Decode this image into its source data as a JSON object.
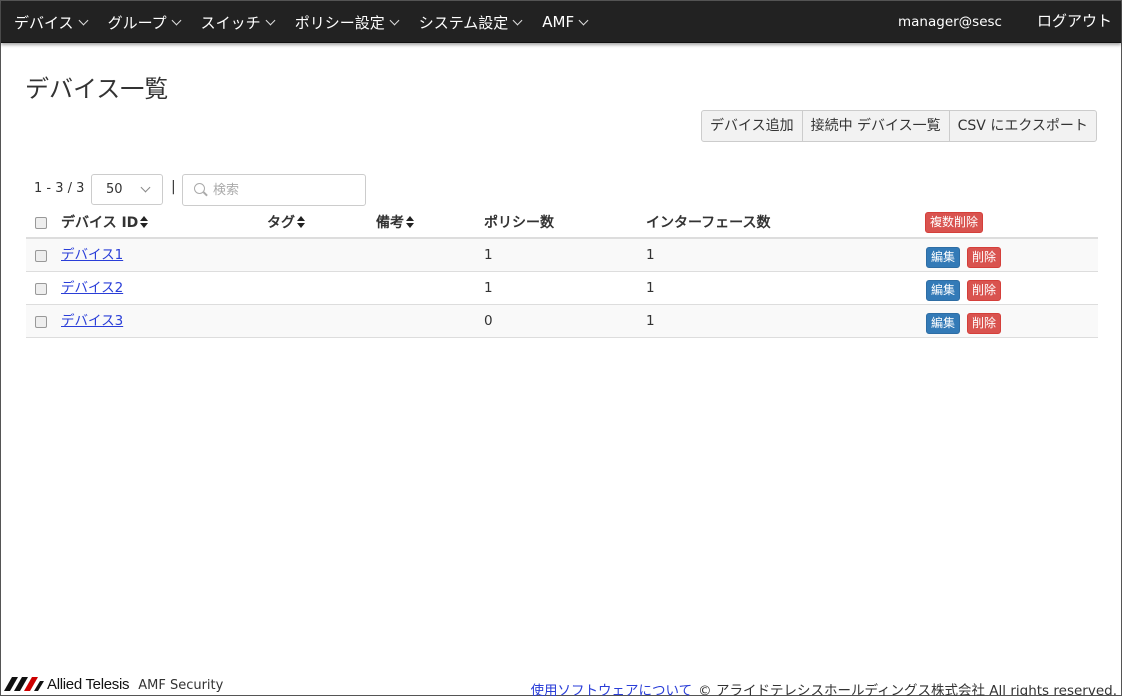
{
  "nav": {
    "items": [
      {
        "label": "デバイス"
      },
      {
        "label": "グループ"
      },
      {
        "label": "スイッチ"
      },
      {
        "label": "ポリシー設定"
      },
      {
        "label": "システム設定"
      },
      {
        "label": "AMF"
      }
    ],
    "user": "manager@sesc",
    "logout": "ログアウト"
  },
  "page": {
    "title": "デバイス一覧"
  },
  "toolbar": {
    "add_device": "デバイス追加",
    "connected_devices": "接続中 デバイス一覧",
    "export_csv": "CSV にエクスポート"
  },
  "list": {
    "range_text": "1 - 3 / 3",
    "page_size": "50",
    "separator": "|",
    "search_placeholder": "検索",
    "search_value": ""
  },
  "table": {
    "headers": {
      "device_id": "デバイス ID",
      "tag": "タグ",
      "note": "備考",
      "policy_count": "ポリシー数",
      "interface_count": "インターフェース数"
    },
    "bulk_delete": "複数削除",
    "edit_label": "編集",
    "delete_label": "削除",
    "rows": [
      {
        "device": "デバイス1",
        "tag": "",
        "note": "",
        "policies": "1",
        "interfaces": "1"
      },
      {
        "device": "デバイス2",
        "tag": "",
        "note": "",
        "policies": "1",
        "interfaces": "1"
      },
      {
        "device": "デバイス3",
        "tag": "",
        "note": "",
        "policies": "0",
        "interfaces": "1"
      }
    ]
  },
  "footer": {
    "brand": "Allied Telesis",
    "product": "AMF Security",
    "software_link": "使用ソフトウェアについて",
    "copyright": "© アライドテレシスホールディングス株式会社 All rights reserved."
  },
  "colors": {
    "navbar": "#222222",
    "primary": "#337ab7",
    "danger": "#d9534f",
    "link": "#2a3ed8"
  }
}
